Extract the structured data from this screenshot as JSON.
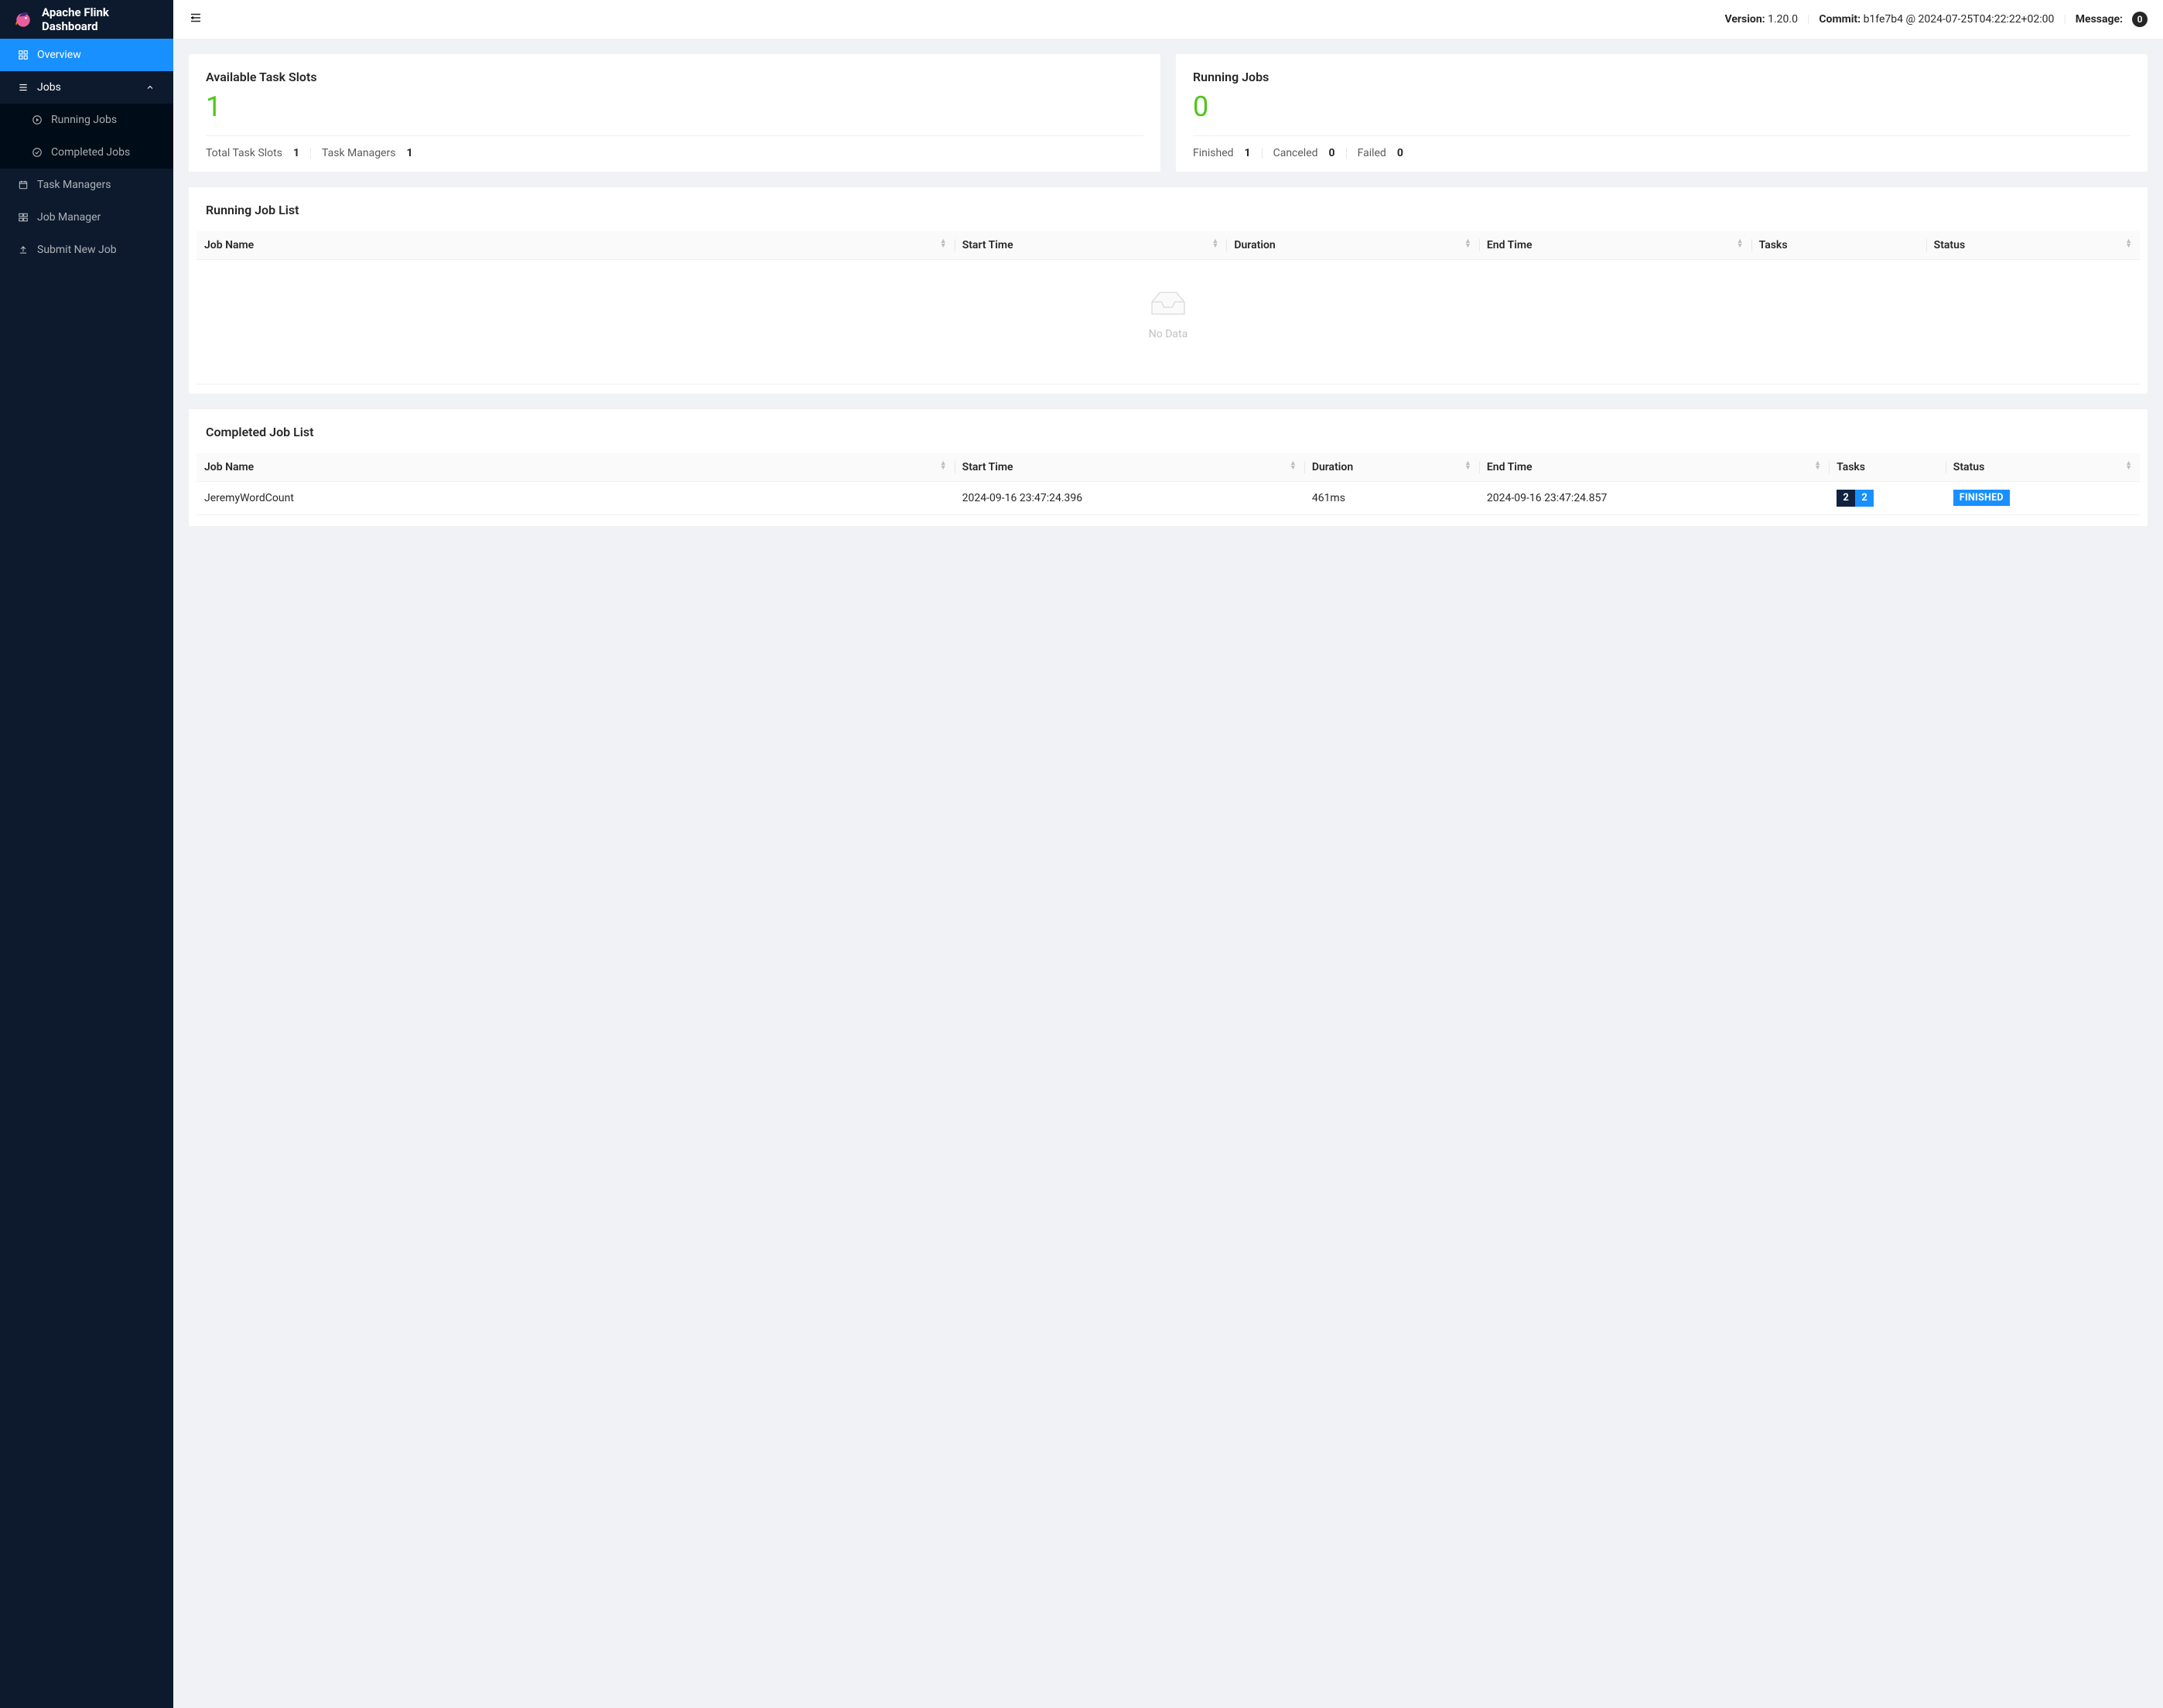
{
  "brand": {
    "title": "Apache Flink Dashboard"
  },
  "header": {
    "version_label": "Version:",
    "version": "1.20.0",
    "commit_label": "Commit:",
    "commit": "b1fe7b4 @ 2024-07-25T04:22:22+02:00",
    "message_label": "Message:",
    "message_count": "0"
  },
  "sidebar": {
    "overview": "Overview",
    "jobs": "Jobs",
    "running_jobs": "Running Jobs",
    "completed_jobs": "Completed Jobs",
    "task_managers": "Task Managers",
    "job_manager": "Job Manager",
    "submit_new_job": "Submit New Job"
  },
  "stats": {
    "available_slots": {
      "title": "Available Task Slots",
      "value": "1",
      "total_label": "Total Task Slots",
      "total_value": "1",
      "tm_label": "Task Managers",
      "tm_value": "1"
    },
    "running_jobs": {
      "title": "Running Jobs",
      "value": "0",
      "finished_label": "Finished",
      "finished_value": "1",
      "canceled_label": "Canceled",
      "canceled_value": "0",
      "failed_label": "Failed",
      "failed_value": "0"
    }
  },
  "running_list": {
    "title": "Running Job List",
    "columns": {
      "job_name": "Job Name",
      "start_time": "Start Time",
      "duration": "Duration",
      "end_time": "End Time",
      "tasks": "Tasks",
      "status": "Status"
    },
    "empty": "No Data"
  },
  "completed_list": {
    "title": "Completed Job List",
    "columns": {
      "job_name": "Job Name",
      "start_time": "Start Time",
      "duration": "Duration",
      "end_time": "End Time",
      "tasks": "Tasks",
      "status": "Status"
    },
    "rows": [
      {
        "job_name": "JeremyWordCount",
        "start_time": "2024-09-16 23:47:24.396",
        "duration": "461ms",
        "end_time": "2024-09-16 23:47:24.857",
        "tasks_a": "2",
        "tasks_b": "2",
        "status": "FINISHED"
      }
    ]
  }
}
